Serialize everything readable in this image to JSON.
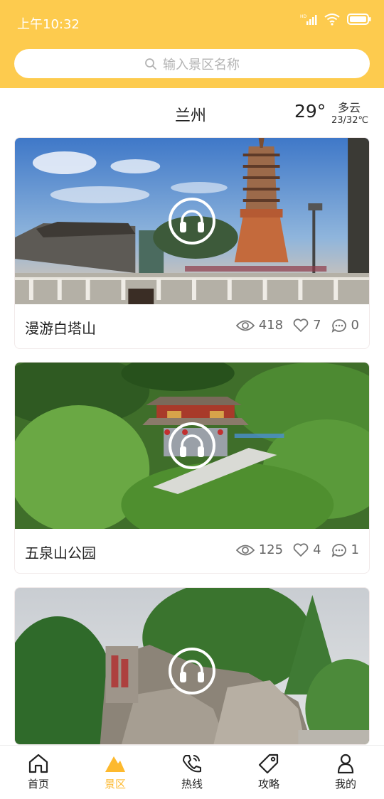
{
  "status": {
    "time": "上午10:32",
    "network_badge": "HD"
  },
  "search": {
    "placeholder": "输入景区名称"
  },
  "weather": {
    "city": "兰州",
    "temp": "29°",
    "desc": "多云",
    "range": "23/32℃"
  },
  "cards": [
    {
      "title": "漫游白塔山",
      "views": "418",
      "likes": "7",
      "comments": "0"
    },
    {
      "title": "五泉山公园",
      "views": "125",
      "likes": "4",
      "comments": "1"
    },
    {
      "title": "",
      "views": "",
      "likes": "",
      "comments": ""
    }
  ],
  "tabs": [
    {
      "label": "首页",
      "icon": "home-icon"
    },
    {
      "label": "景区",
      "icon": "mountain-icon",
      "active": true
    },
    {
      "label": "热线",
      "icon": "phone-icon"
    },
    {
      "label": "攻略",
      "icon": "tag-icon"
    },
    {
      "label": "我的",
      "icon": "user-icon"
    }
  ],
  "colors": {
    "header": "#FDCB4E",
    "active_tab": "#FDB92E"
  }
}
